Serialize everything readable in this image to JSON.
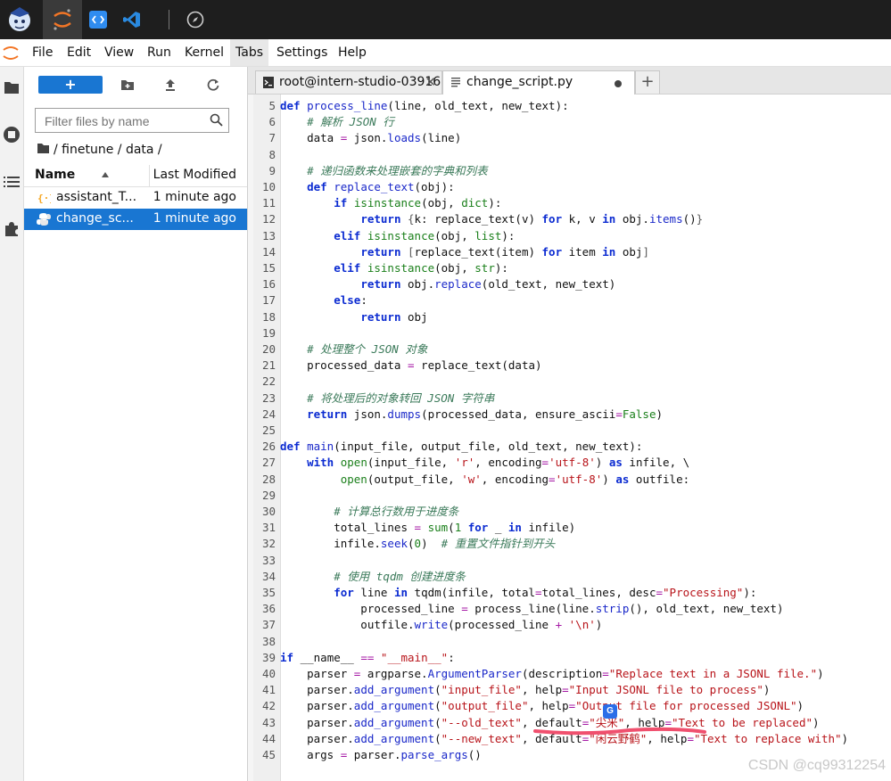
{
  "topbar": {
    "apps": [
      {
        "name": "intern-studio-logo"
      },
      {
        "name": "jupyter-app"
      },
      {
        "name": "code-editor-app"
      },
      {
        "name": "vscode-app"
      },
      {
        "name": "compass-app"
      }
    ]
  },
  "menubar": {
    "items": [
      "File",
      "Edit",
      "View",
      "Run",
      "Kernel",
      "Tabs",
      "Settings",
      "Help"
    ],
    "active": "Tabs"
  },
  "filebrowser": {
    "new_label": "+",
    "search_placeholder": "Filter files by name",
    "breadcrumb": "/ finetune / data /",
    "col_name": "Name",
    "col_modified": "Last Modified",
    "files": [
      {
        "name": "assistant_T...",
        "modified": "1 minute ago",
        "icon": "json-icon",
        "selected": false
      },
      {
        "name": "change_sc...",
        "modified": "1 minute ago",
        "icon": "python-icon",
        "selected": true
      }
    ]
  },
  "tabs": [
    {
      "label": "root@intern-studio-03916",
      "icon": "terminal-icon"
    },
    {
      "label": "change_script.py",
      "icon": "file-icon"
    }
  ],
  "code": {
    "lines": [
      {
        "n": "5",
        "t": "def process_line(line, old_text, new_text):"
      },
      {
        "n": "6",
        "t": "    # 解析 JSON 行"
      },
      {
        "n": "7",
        "t": "    data = json.loads(line)"
      },
      {
        "n": "8",
        "t": ""
      },
      {
        "n": "9",
        "t": "    # 递归函数来处理嵌套的字典和列表"
      },
      {
        "n": "10",
        "t": "    def replace_text(obj):"
      },
      {
        "n": "11",
        "t": "        if isinstance(obj, dict):"
      },
      {
        "n": "12",
        "t": "            return {k: replace_text(v) for k, v in obj.items()}"
      },
      {
        "n": "13",
        "t": "        elif isinstance(obj, list):"
      },
      {
        "n": "14",
        "t": "            return [replace_text(item) for item in obj]"
      },
      {
        "n": "15",
        "t": "        elif isinstance(obj, str):"
      },
      {
        "n": "16",
        "t": "            return obj.replace(old_text, new_text)"
      },
      {
        "n": "17",
        "t": "        else:"
      },
      {
        "n": "18",
        "t": "            return obj"
      },
      {
        "n": "19",
        "t": ""
      },
      {
        "n": "20",
        "t": "    # 处理整个 JSON 对象"
      },
      {
        "n": "21",
        "t": "    processed_data = replace_text(data)"
      },
      {
        "n": "22",
        "t": ""
      },
      {
        "n": "23",
        "t": "    # 将处理后的对象转回 JSON 字符串"
      },
      {
        "n": "24",
        "t": "    return json.dumps(processed_data, ensure_ascii=False)"
      },
      {
        "n": "25",
        "t": ""
      },
      {
        "n": "26",
        "t": "def main(input_file, output_file, old_text, new_text):"
      },
      {
        "n": "27",
        "t": "    with open(input_file, 'r', encoding='utf-8') as infile, \\"
      },
      {
        "n": "28",
        "t": "         open(output_file, 'w', encoding='utf-8') as outfile:"
      },
      {
        "n": "29",
        "t": ""
      },
      {
        "n": "30",
        "t": "        # 计算总行数用于进度条"
      },
      {
        "n": "31",
        "t": "        total_lines = sum(1 for _ in infile)"
      },
      {
        "n": "32",
        "t": "        infile.seek(0)  # 重置文件指针到开头"
      },
      {
        "n": "33",
        "t": ""
      },
      {
        "n": "34",
        "t": "        # 使用 tqdm 创建进度条"
      },
      {
        "n": "35",
        "t": "        for line in tqdm(infile, total=total_lines, desc=\"Processing\"):"
      },
      {
        "n": "36",
        "t": "            processed_line = process_line(line.strip(), old_text, new_text)"
      },
      {
        "n": "37",
        "t": "            outfile.write(processed_line + '\\n')"
      },
      {
        "n": "38",
        "t": ""
      },
      {
        "n": "39",
        "t": "if __name__ == \"__main__\":"
      },
      {
        "n": "40",
        "t": "    parser = argparse.ArgumentParser(description=\"Replace text in a JSONL file.\")"
      },
      {
        "n": "41",
        "t": "    parser.add_argument(\"input_file\", help=\"Input JSONL file to process\")"
      },
      {
        "n": "42",
        "t": "    parser.add_argument(\"output_file\", help=\"Output file for processed JSONL\")"
      },
      {
        "n": "43",
        "t": "    parser.add_argument(\"--old_text\", default=\"尖米\", help=\"Text to be replaced\")"
      },
      {
        "n": "44",
        "t": "    parser.add_argument(\"--new_text\", default=\"闲云野鹤\", help=\"Text to replace with\")"
      },
      {
        "n": "45",
        "t": "    args = parser.parse_args()"
      }
    ]
  },
  "watermark": "CSDN @cq99312254",
  "colors": {
    "accent": "#1976d2",
    "topbar": "#1e1e1e",
    "underline": "#f0506e"
  }
}
